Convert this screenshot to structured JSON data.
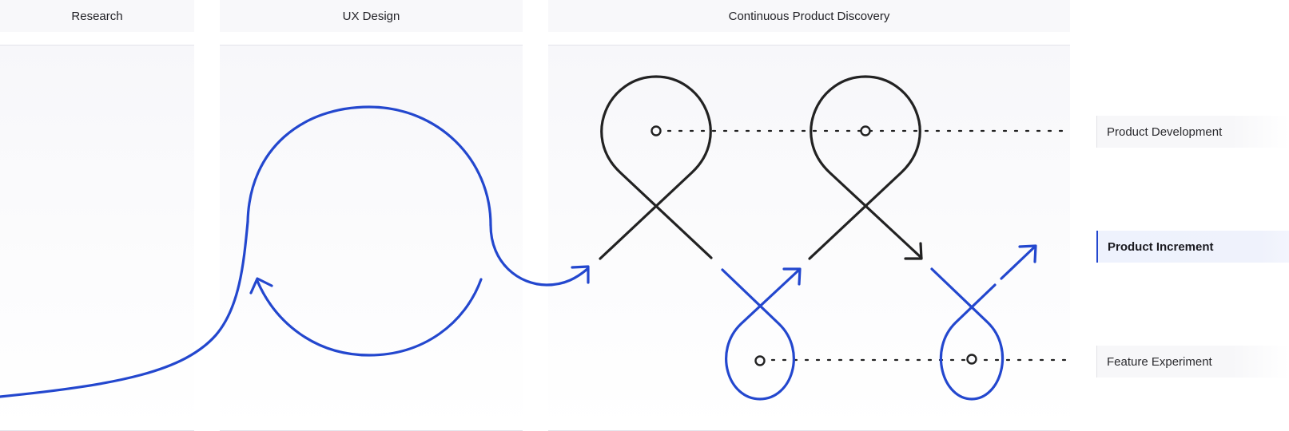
{
  "columns": [
    {
      "title": "Research"
    },
    {
      "title": "UX Design"
    },
    {
      "title": "Continuous Product Discovery"
    }
  ],
  "lanes": [
    {
      "label": "Product Development",
      "active": false
    },
    {
      "label": "Product Increment",
      "active": true
    },
    {
      "label": "Feature Experiment",
      "active": false
    }
  ],
  "colors": {
    "accent_blue": "#2347CE",
    "loop_dark": "#222222",
    "header_bg": "#F8F8FA",
    "active_lane_bg": "#EEF2FD"
  }
}
